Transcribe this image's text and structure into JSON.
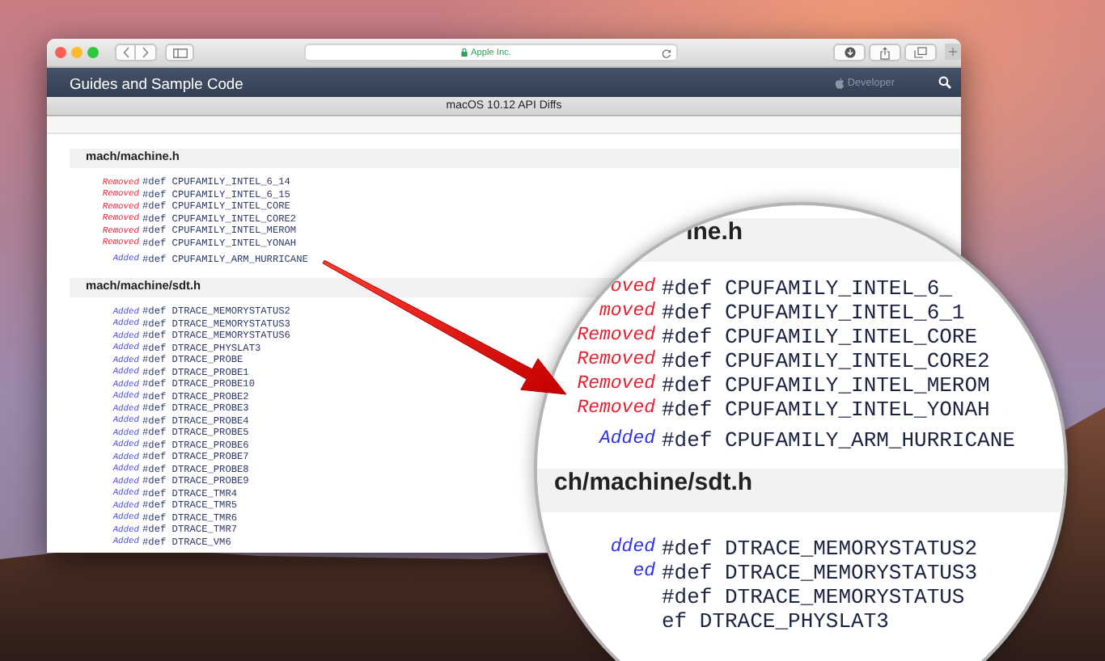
{
  "browser": {
    "address": "Apple Inc.",
    "site_title": "Guides and Sample Code",
    "brand": "Developer",
    "page_title": "macOS 10.12 API Diffs"
  },
  "sections": [
    {
      "header": "mach/machine.h",
      "entries": [
        {
          "kind": "removed",
          "tag": "Removed",
          "code": "#def CPUFAMILY_INTEL_6_14"
        },
        {
          "kind": "removed",
          "tag": "Removed",
          "code": "#def CPUFAMILY_INTEL_6_15"
        },
        {
          "kind": "removed",
          "tag": "Removed",
          "code": "#def CPUFAMILY_INTEL_CORE"
        },
        {
          "kind": "removed",
          "tag": "Removed",
          "code": "#def CPUFAMILY_INTEL_CORE2"
        },
        {
          "kind": "removed",
          "tag": "Removed",
          "code": "#def CPUFAMILY_INTEL_MEROM"
        },
        {
          "kind": "removed",
          "tag": "Removed",
          "code": "#def CPUFAMILY_INTEL_YONAH"
        },
        {
          "kind": "added",
          "tag": "Added",
          "code": "#def CPUFAMILY_ARM_HURRICANE"
        }
      ]
    },
    {
      "header": "mach/machine/sdt.h",
      "entries": [
        {
          "kind": "added",
          "tag": "Added",
          "code": "#def DTRACE_MEMORYSTATUS2"
        },
        {
          "kind": "added",
          "tag": "Added",
          "code": "#def DTRACE_MEMORYSTATUS3"
        },
        {
          "kind": "added",
          "tag": "Added",
          "code": "#def DTRACE_MEMORYSTATUS6"
        },
        {
          "kind": "added",
          "tag": "Added",
          "code": "#def DTRACE_PHYSLAT3"
        },
        {
          "kind": "added",
          "tag": "Added",
          "code": "#def DTRACE_PROBE"
        },
        {
          "kind": "added",
          "tag": "Added",
          "code": "#def DTRACE_PROBE1"
        },
        {
          "kind": "added",
          "tag": "Added",
          "code": "#def DTRACE_PROBE10"
        },
        {
          "kind": "added",
          "tag": "Added",
          "code": "#def DTRACE_PROBE2"
        },
        {
          "kind": "added",
          "tag": "Added",
          "code": "#def DTRACE_PROBE3"
        },
        {
          "kind": "added",
          "tag": "Added",
          "code": "#def DTRACE_PROBE4"
        },
        {
          "kind": "added",
          "tag": "Added",
          "code": "#def DTRACE_PROBE5"
        },
        {
          "kind": "added",
          "tag": "Added",
          "code": "#def DTRACE_PROBE6"
        },
        {
          "kind": "added",
          "tag": "Added",
          "code": "#def DTRACE_PROBE7"
        },
        {
          "kind": "added",
          "tag": "Added",
          "code": "#def DTRACE_PROBE8"
        },
        {
          "kind": "added",
          "tag": "Added",
          "code": "#def DTRACE_PROBE9"
        },
        {
          "kind": "added",
          "tag": "Added",
          "code": "#def DTRACE_TMR4"
        },
        {
          "kind": "added",
          "tag": "Added",
          "code": "#def DTRACE_TMR5"
        },
        {
          "kind": "added",
          "tag": "Added",
          "code": "#def DTRACE_TMR6"
        },
        {
          "kind": "added",
          "tag": "Added",
          "code": "#def DTRACE_TMR7"
        },
        {
          "kind": "added",
          "tag": "Added",
          "code": "#def DTRACE_VM6"
        }
      ]
    }
  ],
  "magnifier": {
    "rows": [
      {
        "kind": "header",
        "text": "ine.h"
      },
      {
        "kind": "removed",
        "tag": "oved",
        "code": "#def CPUFAMILY_INTEL_6_"
      },
      {
        "kind": "removed",
        "tag": "moved",
        "code": "#def CPUFAMILY_INTEL_6_1"
      },
      {
        "kind": "removed",
        "tag": "Removed",
        "code": "#def CPUFAMILY_INTEL_CORE"
      },
      {
        "kind": "removed",
        "tag": "Removed",
        "code": "#def CPUFAMILY_INTEL_CORE2"
      },
      {
        "kind": "removed",
        "tag": "Removed",
        "code": "#def CPUFAMILY_INTEL_MEROM"
      },
      {
        "kind": "removed",
        "tag": "Removed",
        "code": "#def CPUFAMILY_INTEL_YONAH"
      },
      {
        "kind": "added",
        "tag": "Added",
        "code": "#def CPUFAMILY_ARM_HURRICANE"
      },
      {
        "kind": "header",
        "text": "ch/machine/sdt.h"
      },
      {
        "kind": "added",
        "tag": "dded",
        "code": "#def DTRACE_MEMORYSTATUS2"
      },
      {
        "kind": "added",
        "tag": "ed",
        "code": "#def DTRACE_MEMORYSTATUS3"
      },
      {
        "kind": "added",
        "code": "#def DTRACE_MEMORYSTATUS"
      },
      {
        "kind": "added",
        "code": "ef DTRACE_PHYSLAT3"
      }
    ]
  }
}
